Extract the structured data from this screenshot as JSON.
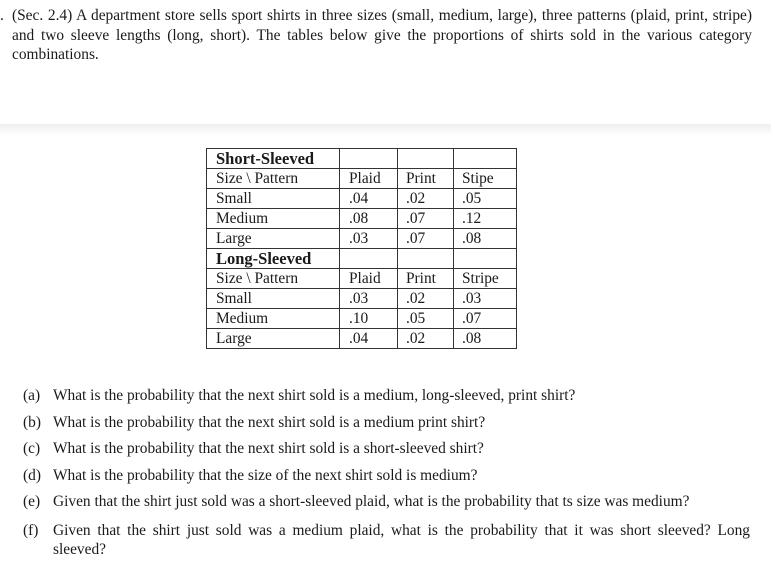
{
  "problem": {
    "number": ".",
    "intro": "(Sec. 2.4) A department store sells sport shirts in three sizes (small, medium, large), three patterns (plaid, print, stripe) and two sleeve lengths (long, short). The tables below give the proportions of shirts sold in the various category combinations."
  },
  "tables": [
    {
      "title": "Short-Sleeved",
      "header": [
        "Size \\ Pattern",
        "Plaid",
        "Print",
        "Stipe"
      ],
      "rows": [
        [
          "Small",
          ".04",
          ".02",
          ".05"
        ],
        [
          "Medium",
          ".08",
          ".07",
          ".12"
        ],
        [
          "Large",
          ".03",
          ".07",
          ".08"
        ]
      ]
    },
    {
      "title": "Long-Sleeved",
      "header": [
        "Size \\ Pattern",
        "Plaid",
        "Print",
        "Stripe"
      ],
      "rows": [
        [
          "Small",
          ".03",
          ".02",
          ".03"
        ],
        [
          "Medium",
          ".10",
          ".05",
          ".07"
        ],
        [
          "Large",
          ".04",
          ".02",
          ".08"
        ]
      ]
    }
  ],
  "questions": [
    {
      "tag": "(a)",
      "text": "What is the probability that the next shirt sold is a medium, long-sleeved, print shirt?"
    },
    {
      "tag": "(b)",
      "text": "What is the probability that the next shirt sold is a medium print shirt?"
    },
    {
      "tag": "(c)",
      "text": "What is the probability that the next shirt sold is a short-sleeved shirt?"
    },
    {
      "tag": "(d)",
      "text": "What is the probability that the size of the next shirt sold is medium?"
    },
    {
      "tag": "(e)",
      "text": "Given that the shirt just sold was a short-sleeved plaid, what is the probability that ts size was medium?"
    },
    {
      "tag": "(f)",
      "text": "Given that the shirt just sold was a medium plaid, what is the probability that it was short sleeved? Long sleeved?"
    }
  ]
}
